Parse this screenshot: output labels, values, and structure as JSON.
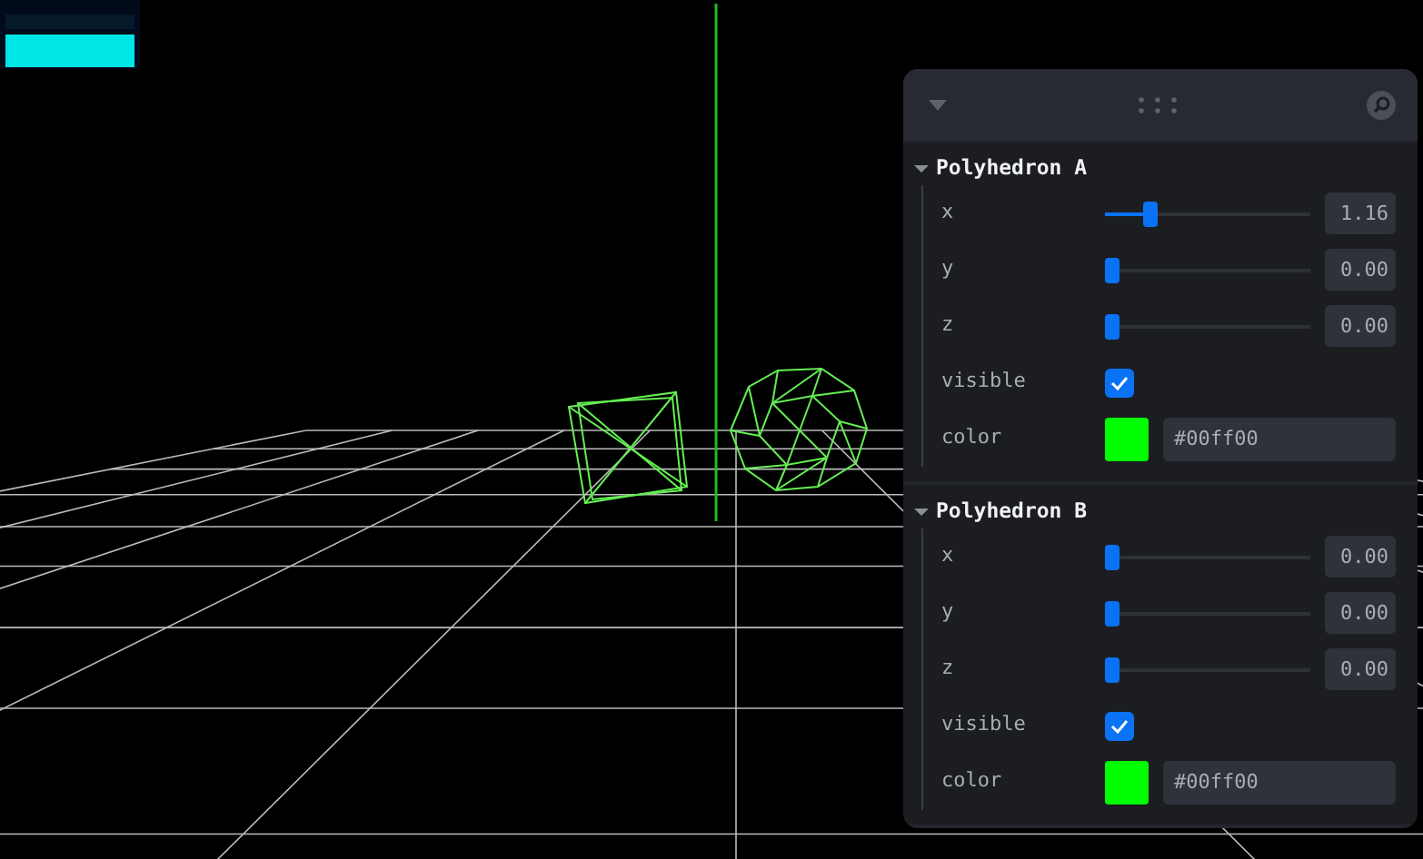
{
  "panel": {
    "folders": [
      {
        "title": "Polyhedron A",
        "expanded": true,
        "controls": [
          {
            "kind": "slider",
            "label": "x",
            "level": 0.2,
            "value": "1.16"
          },
          {
            "kind": "slider",
            "label": "y",
            "level": 0,
            "value": "0.00"
          },
          {
            "kind": "slider",
            "label": "z",
            "level": 0,
            "value": "0.00"
          },
          {
            "kind": "checkbox",
            "label": "visible",
            "checked": true
          },
          {
            "kind": "color",
            "label": "color",
            "color": "#00ff00",
            "value": "#00ff00"
          }
        ]
      },
      {
        "title": "Polyhedron B",
        "expanded": true,
        "controls": [
          {
            "kind": "slider",
            "label": "x",
            "level": 0,
            "value": "0.00"
          },
          {
            "kind": "slider",
            "label": "y",
            "level": 0,
            "value": "0.00"
          },
          {
            "kind": "slider",
            "label": "z",
            "level": 0,
            "value": "0.00"
          },
          {
            "kind": "checkbox",
            "label": "visible",
            "checked": true
          },
          {
            "kind": "color",
            "label": "color",
            "color": "#00ff00",
            "value": "#00ff00"
          }
        ]
      }
    ]
  }
}
